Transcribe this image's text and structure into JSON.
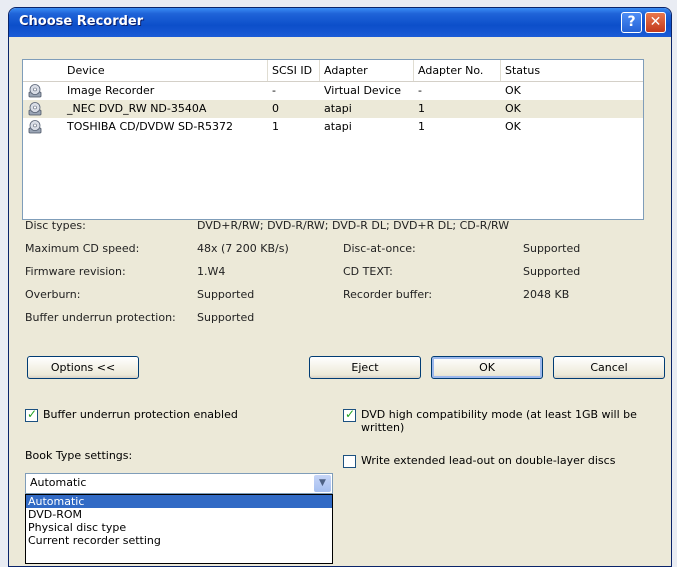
{
  "window": {
    "title": "Choose Recorder",
    "help_glyph": "?",
    "close_glyph": "✕"
  },
  "recorders": {
    "columns": [
      "Device",
      "SCSI ID",
      "Adapter",
      "Adapter No.",
      "Status"
    ],
    "rows": [
      {
        "device": "Image Recorder",
        "scsi_id": "-",
        "adapter": "Virtual Device",
        "adapter_no": "-",
        "status": "OK",
        "icon": "disc-drive-icon",
        "selected": false
      },
      {
        "device": "_NEC    DVD_RW ND-3540A",
        "scsi_id": "0",
        "adapter": "atapi",
        "adapter_no": "1",
        "status": "OK",
        "icon": "disc-drive-icon",
        "selected": true
      },
      {
        "device": "TOSHIBA  CD/DVDW SD-R5372",
        "scsi_id": "1",
        "adapter": "atapi",
        "adapter_no": "1",
        "status": "OK",
        "icon": "disc-drive-icon",
        "selected": false
      }
    ]
  },
  "details": {
    "disc_types_label": "Disc types:",
    "disc_types_value": "DVD+R/RW; DVD-R/RW; DVD-R DL; DVD+R DL; CD-R/RW",
    "max_speed_label": "Maximum CD speed:",
    "max_speed_value": "48x (7 200 KB/s)",
    "firmware_label": "Firmware revision:",
    "firmware_value": "1.W4",
    "overburn_label": "Overburn:",
    "overburn_value": "Supported",
    "buffer_protection_label": "Buffer underrun protection:",
    "buffer_protection_value": "Supported",
    "dao_label": "Disc-at-once:",
    "dao_value": "Supported",
    "cdtext_label": "CD TEXT:",
    "cdtext_value": "Supported",
    "buffer_label": "Recorder buffer:",
    "buffer_value": "2048 KB"
  },
  "buttons": {
    "options": "Options <<",
    "eject": "Eject",
    "ok": "OK",
    "cancel": "Cancel"
  },
  "options": {
    "buffer_underrun_label": "Buffer underrun protection enabled",
    "buffer_underrun_checked": true,
    "dvd_compat_label": "DVD high compatibility mode (at least 1GB will be written)",
    "dvd_compat_checked": true,
    "extended_leadout_label": "Write extended lead-out on double-layer discs",
    "extended_leadout_checked": false,
    "book_type_label": "Book Type settings:",
    "book_type_selected": "Automatic",
    "book_type_options": [
      "Automatic",
      "DVD-ROM",
      "Physical disc type",
      "Current recorder setting"
    ]
  }
}
